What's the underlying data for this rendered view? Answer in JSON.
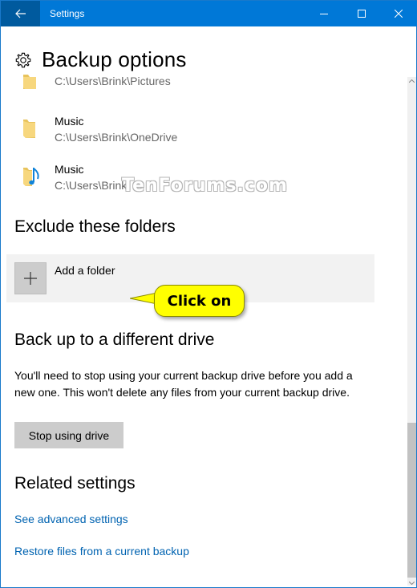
{
  "window": {
    "title": "Settings",
    "accent_color": "#0078d7",
    "back_button_color": "#005a9e"
  },
  "page": {
    "title": "Backup options",
    "icon": "gear-icon"
  },
  "backup_folders": [
    {
      "name": "",
      "path": "C:\\Users\\Brink\\Pictures",
      "icon": "folder-icon"
    },
    {
      "name": "Music",
      "path": "C:\\Users\\Brink\\OneDrive",
      "icon": "folder-icon"
    },
    {
      "name": "Music",
      "path": "C:\\Users\\Brink",
      "icon": "music-folder-icon"
    }
  ],
  "exclude": {
    "title": "Exclude these folders",
    "add_label": "Add a folder"
  },
  "callout": {
    "text": "Click on"
  },
  "watermark": "TenForums.com",
  "different_drive": {
    "title": "Back up to a different drive",
    "description": "You'll need to stop using your current backup drive before you add a new one. This won't delete any files from your current backup drive.",
    "button_label": "Stop using drive"
  },
  "related": {
    "title": "Related settings",
    "links": [
      "See advanced settings",
      "Restore files from a current backup"
    ],
    "link_color": "#0063b1"
  },
  "scrollbar": {
    "position_fraction": 1.0
  }
}
